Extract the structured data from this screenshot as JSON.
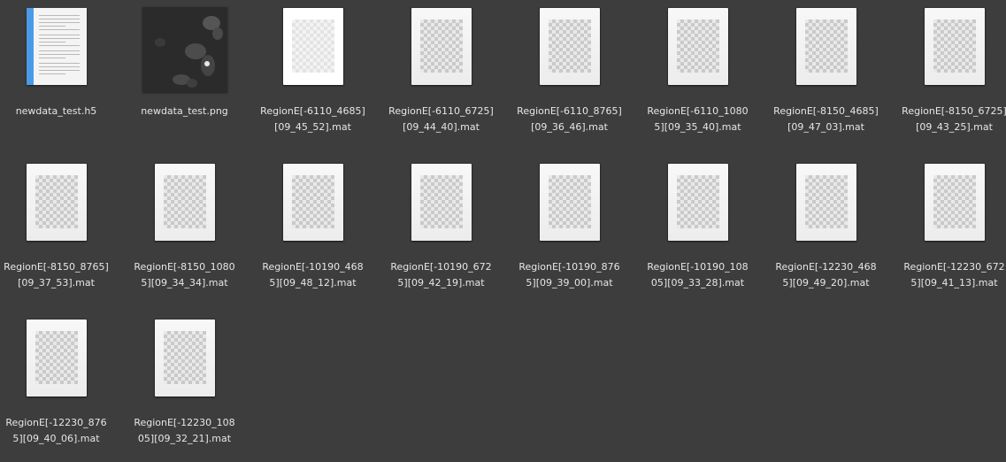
{
  "files": [
    {
      "name": "newdata_test.h5",
      "icon": "text-document-icon",
      "type": "h5"
    },
    {
      "name": "newdata_test.png",
      "icon": "image-thumbnail",
      "type": "png"
    },
    {
      "name": "RegionE[-6110_4685]\n[09_45_52].mat",
      "icon": "file-icon",
      "type": "mat-plain"
    },
    {
      "name": "RegionE[-6110_6725]\n[09_44_40].mat",
      "icon": "file-icon",
      "type": "mat"
    },
    {
      "name": "RegionE[-6110_8765]\n[09_36_46].mat",
      "icon": "file-icon",
      "type": "mat"
    },
    {
      "name": "RegionE[-6110_1080\n5][09_35_40].mat",
      "icon": "file-icon",
      "type": "mat"
    },
    {
      "name": "RegionE[-8150_4685]\n[09_47_03].mat",
      "icon": "file-icon",
      "type": "mat"
    },
    {
      "name": "RegionE[-8150_6725]\n[09_43_25].mat",
      "icon": "file-icon",
      "type": "mat"
    },
    {
      "name": "RegionE[-8150_8765]\n[09_37_53].mat",
      "icon": "file-icon",
      "type": "mat"
    },
    {
      "name": "RegionE[-8150_1080\n5][09_34_34].mat",
      "icon": "file-icon",
      "type": "mat"
    },
    {
      "name": "RegionE[-10190_468\n5][09_48_12].mat",
      "icon": "file-icon",
      "type": "mat"
    },
    {
      "name": "RegionE[-10190_672\n5][09_42_19].mat",
      "icon": "file-icon",
      "type": "mat"
    },
    {
      "name": "RegionE[-10190_876\n5][09_39_00].mat",
      "icon": "file-icon",
      "type": "mat"
    },
    {
      "name": "RegionE[-10190_108\n05][09_33_28].mat",
      "icon": "file-icon",
      "type": "mat"
    },
    {
      "name": "RegionE[-12230_468\n5][09_49_20].mat",
      "icon": "file-icon",
      "type": "mat"
    },
    {
      "name": "RegionE[-12230_672\n5][09_41_13].mat",
      "icon": "file-icon",
      "type": "mat"
    },
    {
      "name": "RegionE[-12230_876\n5][09_40_06].mat",
      "icon": "file-icon",
      "type": "mat"
    },
    {
      "name": "RegionE[-12230_108\n05][09_32_21].mat",
      "icon": "file-icon",
      "type": "mat"
    }
  ],
  "colors": {
    "background": "#3d3d3d",
    "label_text": "#e6e6e6",
    "h5_spine": "#4a9ae8"
  }
}
